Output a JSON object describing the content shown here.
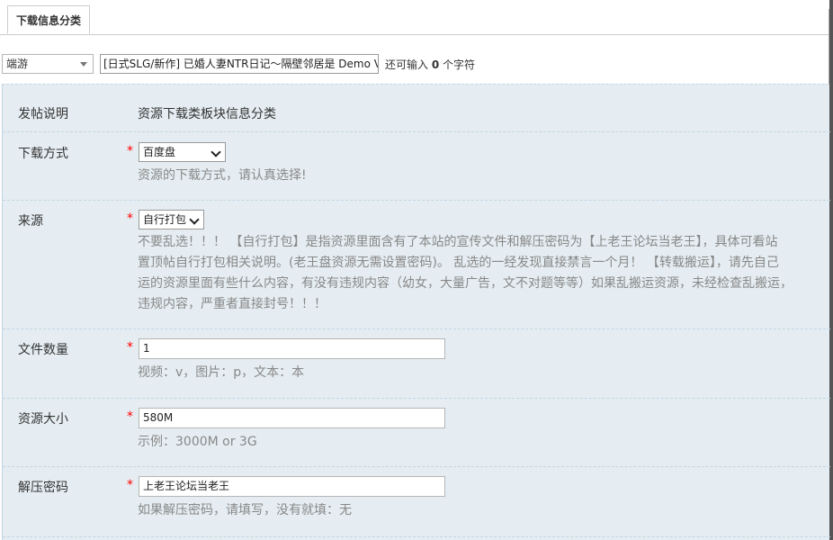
{
  "tabs": [
    {
      "label": "下载信息分类"
    }
  ],
  "thread_type": {
    "selected": "端游"
  },
  "title": {
    "value": "[日式SLG/新作] 已婚人妻NTR日记～隔壁邻居是 Demo Ve"
  },
  "counter": {
    "prefix": "还可输入",
    "count": "0",
    "suffix": "个字符"
  },
  "form": {
    "intro": {
      "label": "发帖说明",
      "value": "资源下载类板块信息分类"
    },
    "download_method": {
      "label": "下载方式",
      "required": "*",
      "selected": "百度盘",
      "hint": "资源的下载方式，请认真选择!"
    },
    "source": {
      "label": "来源",
      "required": "*",
      "selected": "自行打包",
      "hint_lines": [
        "不要乱选！！！ 【自行打包】是指资源里面含有了本站的宣传文件和解压密码为【上老王论坛当老王】，具体可看站",
        "置顶帖自行打包相关说明。(老王盘资源无需设置密码)。 乱选的一经发现直接禁言一个月！ 【转载搬运】，请先自己",
        "运的资源里面有些什么内容，有没有违规内容（幼女，大量广告，文不对题等等）如果乱搬运资源，未经检查乱搬运，",
        "违规内容，严重者直接封号！！！"
      ]
    },
    "file_count": {
      "label": "文件数量",
      "required": "*",
      "value": "1",
      "hint": "视频：v，图片：p，文本：本"
    },
    "size": {
      "label": "资源大小",
      "required": "*",
      "value": "580M",
      "hint": "示例：3000M or 3G"
    },
    "password": {
      "label": "解压密码",
      "required": "*",
      "value": "上老王论坛当老王",
      "hint": "如果解压密码，请填写，没有就填：无"
    }
  }
}
